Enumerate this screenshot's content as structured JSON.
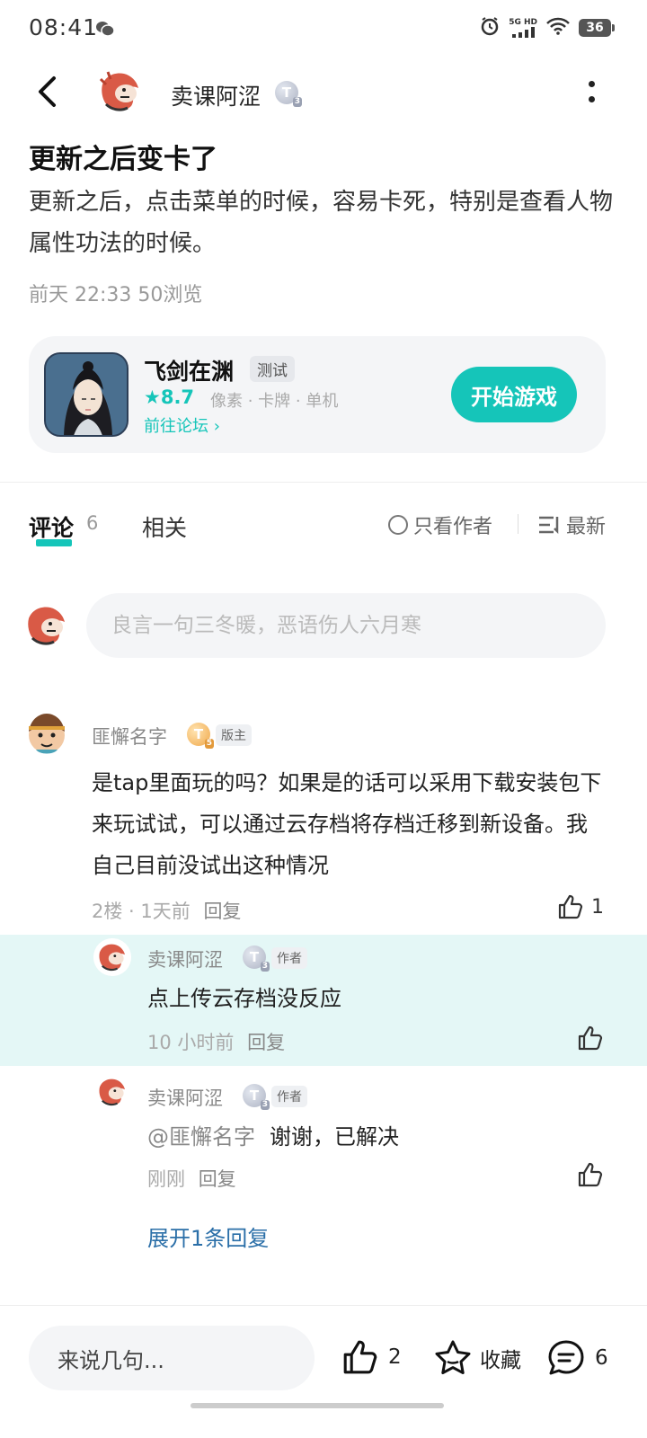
{
  "status": {
    "time": "08:41",
    "network": "5G HD",
    "battery": "36"
  },
  "header": {
    "author_name": "卖课阿涩",
    "author_badge": "T",
    "author_badge_level": "3"
  },
  "post": {
    "title": "更新之后变卡了",
    "body": "更新之后，点击菜单的时候，容易卡死，特别是查看人物属性功法的时候。",
    "meta": "前天 22:33  50浏览"
  },
  "game": {
    "name": "飞剑在渊",
    "tag": "测试",
    "rating": "★8.7",
    "categories": "像素 · 卡牌 · 单机",
    "forum_link": "前往论坛 ›",
    "play_label": "开始游戏"
  },
  "tabs": {
    "comment_label": "评论",
    "comment_count": "6",
    "related_label": "相关",
    "author_only": "只看作者",
    "sort_label": "最新"
  },
  "comment_input": {
    "placeholder": "良言一句三冬暖，恶语伤人六月寒"
  },
  "comments": [
    {
      "name": "匪懈名字",
      "badge": "T",
      "badge_level": "5",
      "role": "版主",
      "text": "是tap里面玩的吗？如果是的话可以采用下载安装包下来玩试试，可以通过云存档将存档迁移到新设备。我自己目前没试出这种情况",
      "meta": "2楼 · 1天前",
      "reply_label": "回复",
      "likes": "1"
    }
  ],
  "replies": [
    {
      "name": "卖课阿涩",
      "badge": "T",
      "badge_level": "3",
      "role": "作者",
      "text": "点上传云存档没反应",
      "meta": "10 小时前",
      "reply_label": "回复"
    },
    {
      "name": "卖课阿涩",
      "badge": "T",
      "badge_level": "3",
      "role": "作者",
      "mention": "@匪懈名字",
      "text": "谢谢，已解决",
      "meta": "刚刚",
      "reply_label": "回复"
    }
  ],
  "expand_replies": "展开1条回复",
  "bottom_bar": {
    "input_label": "来说几句...",
    "like_count": "2",
    "favorite_label": "收藏",
    "comment_count": "6"
  },
  "colors": {
    "accent": "#15c5b9",
    "link": "#2b6fa8",
    "highlight": "#e4f7f6"
  }
}
